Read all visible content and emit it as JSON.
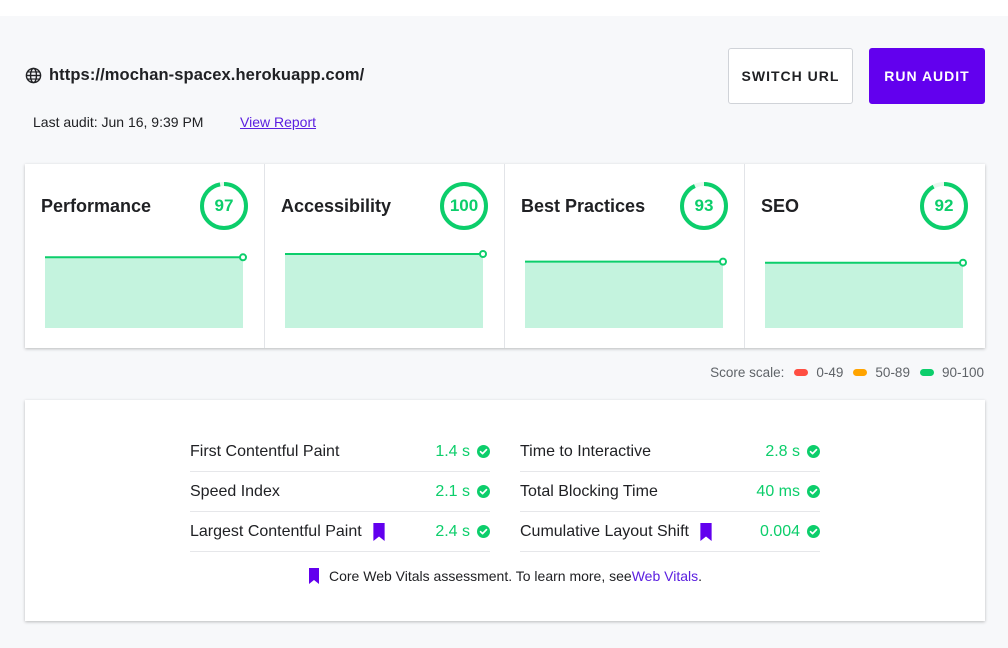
{
  "site": {
    "url": "https://mochan-spacex.herokuapp.com/",
    "icon": "globe-icon"
  },
  "audit": {
    "last_audit": "Last audit: Jun 16, 9:39 PM",
    "view_report": "View Report"
  },
  "buttons": {
    "switch_url": "SWITCH URL",
    "run_audit": "RUN AUDIT"
  },
  "colors": {
    "accent": "#6200ee",
    "good": "#0cce6b",
    "average": "#ffa400",
    "poor": "#ff4e42",
    "fill": "#c4f3de"
  },
  "scores": [
    {
      "title": "Performance",
      "score": "97",
      "trend": [
        97,
        97
      ]
    },
    {
      "title": "Accessibility",
      "score": "100",
      "trend": [
        100,
        100
      ]
    },
    {
      "title": "Best Practices",
      "score": "93",
      "trend": [
        93,
        93
      ]
    },
    {
      "title": "SEO",
      "score": "92",
      "trend": [
        92,
        92
      ]
    }
  ],
  "scale": {
    "label": "Score scale:",
    "poor": "0-49",
    "average": "50-89",
    "good": "90-100"
  },
  "metrics": {
    "left": [
      {
        "label": "First Contentful Paint",
        "value": "1.4 s",
        "core": false
      },
      {
        "label": "Speed Index",
        "value": "2.1 s",
        "core": false
      },
      {
        "label": "Largest Contentful Paint",
        "value": "2.4 s",
        "core": true
      }
    ],
    "right": [
      {
        "label": "Time to Interactive",
        "value": "2.8 s",
        "core": false
      },
      {
        "label": "Total Blocking Time",
        "value": "40 ms",
        "core": false
      },
      {
        "label": "Cumulative Layout Shift",
        "value": "0.004",
        "core": true
      }
    ]
  },
  "footnote": {
    "text": "Core Web Vitals assessment. To learn more, see ",
    "link": "Web Vitals",
    "end": "."
  }
}
